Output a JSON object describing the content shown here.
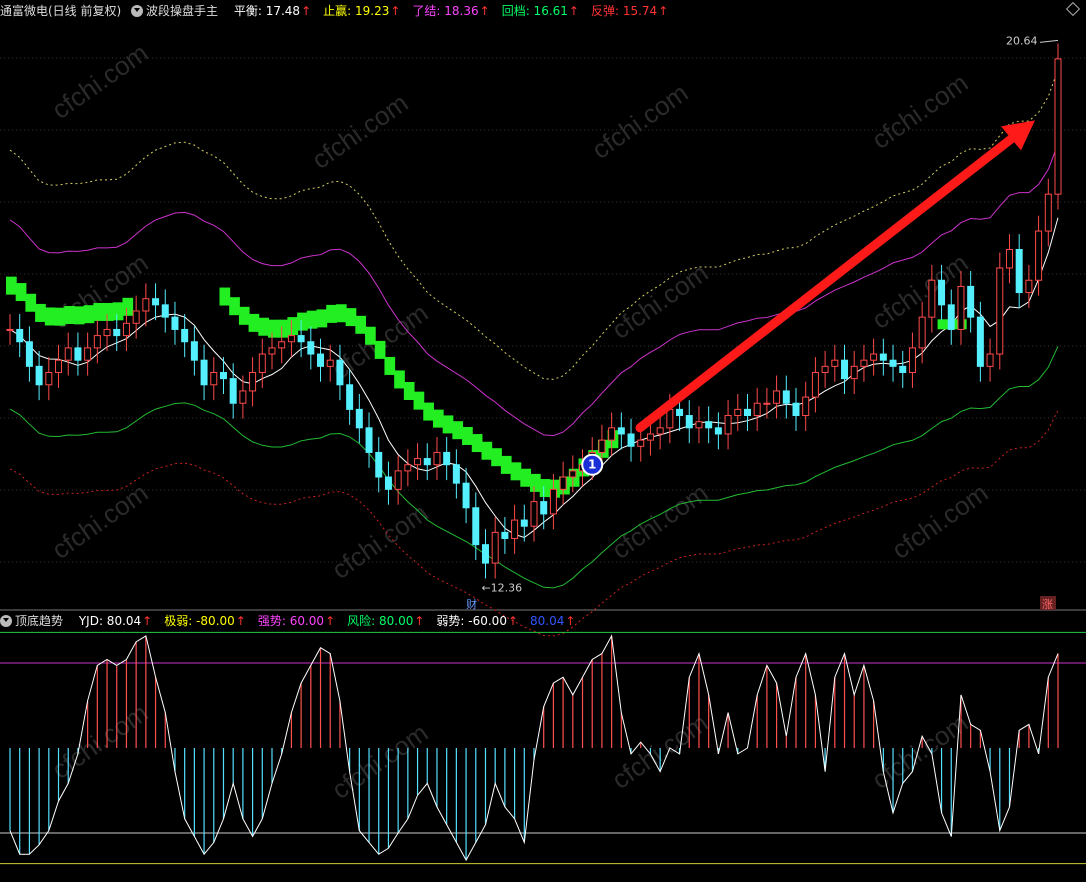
{
  "main_panel": {
    "title": "通富微电(日线 前复权)",
    "indicator_name": "波段操盘手主",
    "values": [
      {
        "label": "平衡:",
        "value": "17.48",
        "color": "#ffffff"
      },
      {
        "label": "止赢:",
        "value": "19.23",
        "color": "#ffff00"
      },
      {
        "label": "了结:",
        "value": "18.36",
        "color": "#ff44ff"
      },
      {
        "label": "回档:",
        "value": "16.61",
        "color": "#00ff66"
      },
      {
        "label": "反弹:",
        "value": "15.74",
        "color": "#ff3333"
      }
    ],
    "high_marker": "20.64",
    "low_marker": "←12.36",
    "signal_label": "1",
    "finance_flag": "财",
    "rise_flag": "涨"
  },
  "sub_panel": {
    "title": "顶底趋势",
    "values": [
      {
        "label": "YJD:",
        "value": "80.04",
        "color": "#ffffff"
      },
      {
        "label": "极弱:",
        "value": "-80.00",
        "color": "#ffff00"
      },
      {
        "label": "强势:",
        "value": "60.00",
        "color": "#ff44ff"
      },
      {
        "label": "风险:",
        "value": "80.00",
        "color": "#00ff66"
      },
      {
        "label": "弱势:",
        "value": "-60.00",
        "color": "#ffffff"
      },
      {
        "label": "",
        "value": "80.04",
        "color": "#3355ff"
      }
    ]
  },
  "watermark": "cfchi.com",
  "chart_data": [
    {
      "type": "candlestick",
      "ylim": [
        11.8,
        21.2
      ],
      "closes": [
        16.2,
        16.0,
        15.6,
        15.3,
        15.5,
        15.7,
        15.9,
        15.7,
        15.9,
        16.1,
        16.2,
        16.1,
        16.3,
        16.5,
        16.7,
        16.6,
        16.4,
        16.2,
        16.0,
        15.7,
        15.3,
        15.5,
        15.4,
        15.0,
        15.2,
        15.5,
        15.8,
        15.9,
        16.0,
        16.1,
        16.0,
        15.8,
        15.6,
        15.7,
        15.3,
        14.9,
        14.6,
        14.2,
        13.8,
        13.6,
        13.9,
        14.0,
        14.1,
        14.0,
        14.2,
        14.0,
        13.7,
        13.3,
        12.7,
        12.4,
        12.9,
        12.8,
        13.1,
        13.0,
        13.4,
        13.2,
        13.6,
        13.8,
        13.9,
        14.0,
        14.2,
        14.4,
        14.6,
        14.5,
        14.3,
        14.4,
        14.5,
        14.6,
        14.9,
        14.8,
        14.6,
        14.7,
        14.6,
        14.5,
        14.8,
        14.9,
        14.8,
        15.0,
        15.0,
        15.2,
        15.0,
        14.8,
        15.1,
        15.5,
        15.6,
        15.7,
        15.4,
        15.6,
        15.7,
        15.8,
        15.7,
        15.6,
        15.5,
        15.9,
        16.4,
        17.0,
        16.6,
        16.2,
        16.9,
        16.4,
        15.6,
        15.8,
        17.2,
        17.5,
        16.8,
        17.0,
        17.8,
        18.4,
        20.6
      ]
    },
    {
      "type": "bar",
      "values": [
        -70,
        -90,
        -90,
        -82,
        -70,
        -45,
        -30,
        -5,
        40,
        70,
        75,
        70,
        75,
        90,
        95,
        60,
        30,
        -20,
        -60,
        -75,
        -90,
        -80,
        -60,
        -30,
        -60,
        -75,
        -60,
        -30,
        -5,
        30,
        55,
        70,
        85,
        80,
        40,
        -20,
        -70,
        -80,
        -90,
        -85,
        -72,
        -60,
        -40,
        -30,
        -50,
        -65,
        -80,
        -95,
        -80,
        -65,
        -30,
        -50,
        -60,
        -80,
        -10,
        35,
        55,
        60,
        45,
        60,
        75,
        80,
        95,
        30,
        -5,
        5,
        -5,
        -20,
        0,
        -5,
        60,
        80,
        45,
        -5,
        30,
        -5,
        0,
        45,
        70,
        55,
        10,
        60,
        80,
        45,
        -20,
        60,
        80,
        45,
        70,
        40,
        -20,
        -55,
        -30,
        -20,
        10,
        -5,
        -55,
        -75,
        45,
        20,
        15,
        -20,
        -70,
        -50,
        15,
        20,
        -5,
        60,
        80
      ]
    }
  ]
}
